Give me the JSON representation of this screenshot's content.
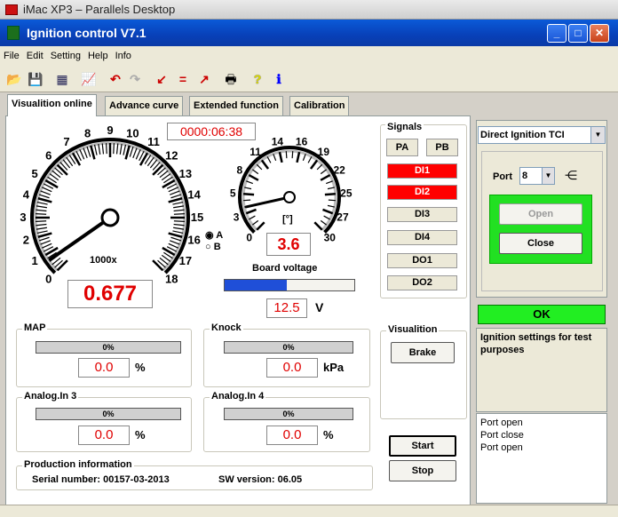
{
  "host": {
    "title": "iMac XP3 – Parallels Desktop"
  },
  "window": {
    "title": "Ignition control  V7.1"
  },
  "menu": [
    "File",
    "Edit",
    "Setting",
    "Help",
    "Info"
  ],
  "tabs": [
    "Visualition online",
    "Advance curve",
    "Extended function",
    "Calibration"
  ],
  "timer": "0000:06:38",
  "gauge_big": {
    "ticks": [
      "0",
      "1",
      "2",
      "3",
      "4",
      "5",
      "6",
      "7",
      "8",
      "9",
      "10",
      "11",
      "12",
      "13",
      "14",
      "15",
      "16",
      "17",
      "18"
    ],
    "unit_label": "1000x",
    "value": 0.677,
    "value_text": "0.677"
  },
  "gauge_small": {
    "ticks": [
      "0",
      "3",
      "5",
      "8",
      "11",
      "14",
      "16",
      "19",
      "22",
      "25",
      "27",
      "30"
    ],
    "unit_label": "[°]",
    "value": 3.6,
    "value_text": "3.6"
  },
  "radio": {
    "a": "A",
    "b": "B",
    "selected": "A"
  },
  "board_voltage": {
    "label": "Board voltage",
    "value_text": "12.5",
    "unit": "V",
    "level": 0.48
  },
  "groups": {
    "map": {
      "title": "MAP",
      "bar_text": "0%",
      "value": "0.0",
      "unit": "%"
    },
    "knock": {
      "title": "Knock",
      "bar_text": "0%",
      "value": "0.0",
      "unit": "kPa"
    },
    "analog3": {
      "title": "Analog.In 3",
      "bar_text": "0%",
      "value": "0.0",
      "unit": "%"
    },
    "analog4": {
      "title": "Analog.In 4",
      "bar_text": "0%",
      "value": "0.0",
      "unit": "%"
    }
  },
  "signals": {
    "title": "Signals",
    "pa": "PA",
    "pb": "PB",
    "items": [
      {
        "label": "DI1",
        "active": true
      },
      {
        "label": "DI2",
        "active": true
      },
      {
        "label": "DI3",
        "active": false
      },
      {
        "label": "DI4",
        "active": false
      },
      {
        "label": "DO1",
        "active": false
      },
      {
        "label": "DO2",
        "active": false
      }
    ]
  },
  "visualition": {
    "title": "Visualition",
    "brake": "Brake"
  },
  "buttons": {
    "start": "Start",
    "stop": "Stop",
    "open": "Open",
    "close": "Close"
  },
  "production": {
    "title": "Production information",
    "serial_label": "Serial number:",
    "serial": "00157-03-2013",
    "sw_label": "SW version:",
    "sw": "06.05"
  },
  "right": {
    "mode": "Direct Ignition TCI",
    "port_label": "Port",
    "port_value": "8",
    "status": "OK",
    "info": "Ignition settings for test purposes",
    "log": [
      "Port open",
      "Port close",
      "Port open"
    ]
  },
  "colors": {
    "accent_red": "#ff0000",
    "status_green": "#22ee22",
    "voltage_blue": "#1f4fd8"
  }
}
